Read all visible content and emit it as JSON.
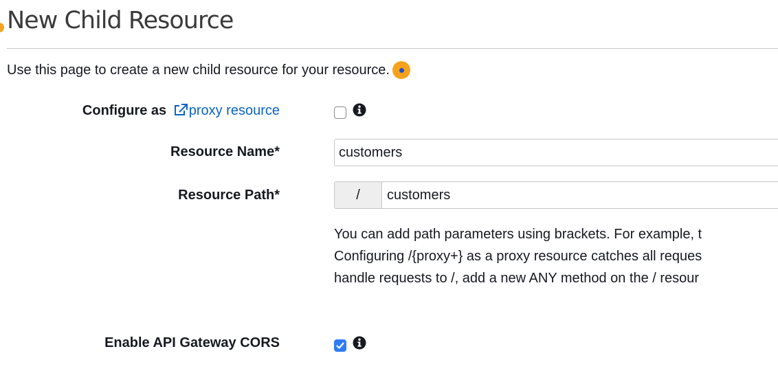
{
  "header": {
    "title": "New Child Resource"
  },
  "intro": {
    "text": "Use this page to create a new child resource for your resource."
  },
  "form": {
    "proxy": {
      "label_prefix": "Configure as",
      "link_text": "proxy resource",
      "checked": false
    },
    "resource_name": {
      "label": "Resource Name*",
      "value": "customers"
    },
    "resource_path": {
      "label": "Resource Path*",
      "prefix": "/",
      "value": "customers"
    },
    "path_help": {
      "lines": [
        "You can add path parameters using brackets. For example, t",
        "Configuring /{proxy+} as a proxy resource catches all reques",
        "handle requests to /, add a new ANY method on the / resour"
      ]
    },
    "cors": {
      "label": "Enable API Gateway CORS",
      "checked": true
    }
  },
  "colors": {
    "accent_orange": "#f7a21c",
    "link_blue": "#0a62c8",
    "checkbox_blue": "#2f7cf6"
  },
  "icons": {
    "help": "help-dot-icon",
    "external_link": "external-link-icon",
    "info": "info-icon",
    "check": "checkmark-icon"
  }
}
